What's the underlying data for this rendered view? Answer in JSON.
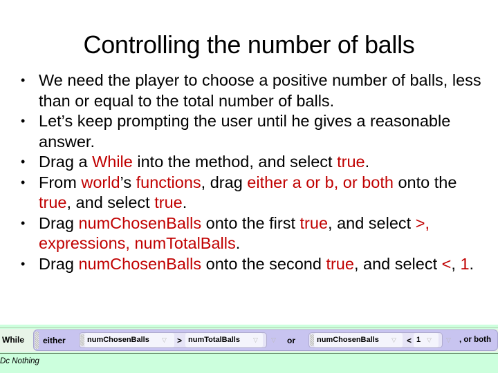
{
  "slide": {
    "title": "Controlling the number of balls",
    "bullets": [
      {
        "parts": [
          {
            "t": "We need the player to choose a positive number of balls, less than or equal to the total number of balls.",
            "red": false
          }
        ]
      },
      {
        "parts": [
          {
            "t": "Let’s keep prompting the user until he gives a reasonable answer.",
            "red": false
          }
        ]
      },
      {
        "parts": [
          {
            "t": "Drag a ",
            "red": false
          },
          {
            "t": "While",
            "red": true
          },
          {
            "t": " into the method, and select ",
            "red": false
          },
          {
            "t": "true",
            "red": true
          },
          {
            "t": ".",
            "red": false
          }
        ]
      },
      {
        "parts": [
          {
            "t": "From ",
            "red": false
          },
          {
            "t": "world",
            "red": true
          },
          {
            "t": "’s ",
            "red": false
          },
          {
            "t": "functions",
            "red": true
          },
          {
            "t": ", drag ",
            "red": false
          },
          {
            "t": "either a or b, or both",
            "red": true
          },
          {
            "t": " onto the ",
            "red": false
          },
          {
            "t": "true",
            "red": true
          },
          {
            "t": ", and select ",
            "red": false
          },
          {
            "t": "true",
            "red": true
          },
          {
            "t": ".",
            "red": false
          }
        ]
      },
      {
        "parts": [
          {
            "t": "Drag ",
            "red": false
          },
          {
            "t": "numChosenBalls",
            "red": true
          },
          {
            "t": " onto the first ",
            "red": false
          },
          {
            "t": "true",
            "red": true
          },
          {
            "t": ", and select ",
            "red": false
          },
          {
            "t": ">, expressions, numTotalBalls",
            "red": true
          },
          {
            "t": ".",
            "red": false
          }
        ]
      },
      {
        "parts": [
          {
            "t": "Drag ",
            "red": false
          },
          {
            "t": "numChosenBalls",
            "red": true
          },
          {
            "t": " onto the second ",
            "red": false
          },
          {
            "t": "true",
            "red": true
          },
          {
            "t": ", and select ",
            "red": false
          },
          {
            "t": "<",
            "red": true
          },
          {
            "t": ", ",
            "red": false
          },
          {
            "t": "1",
            "red": true
          },
          {
            "t": ".",
            "red": false
          }
        ]
      }
    ],
    "colors": {
      "highlight": "#c00000",
      "code_bg": "#ccffdd",
      "block_bg": "#c8c4f0"
    }
  },
  "code": {
    "while_label": "While",
    "either_label": "either",
    "cond1": {
      "left": "numChosenBalls",
      "op": ">",
      "right": "numTotalBalls"
    },
    "or_label": "or",
    "cond2": {
      "left": "numChosenBalls",
      "op": "<",
      "right": "1"
    },
    "or_both_label": ", or both",
    "dropdown_icon": "triangle-down-icon",
    "body": "Do Nothing",
    "body_visible": "Dc Nothing"
  }
}
